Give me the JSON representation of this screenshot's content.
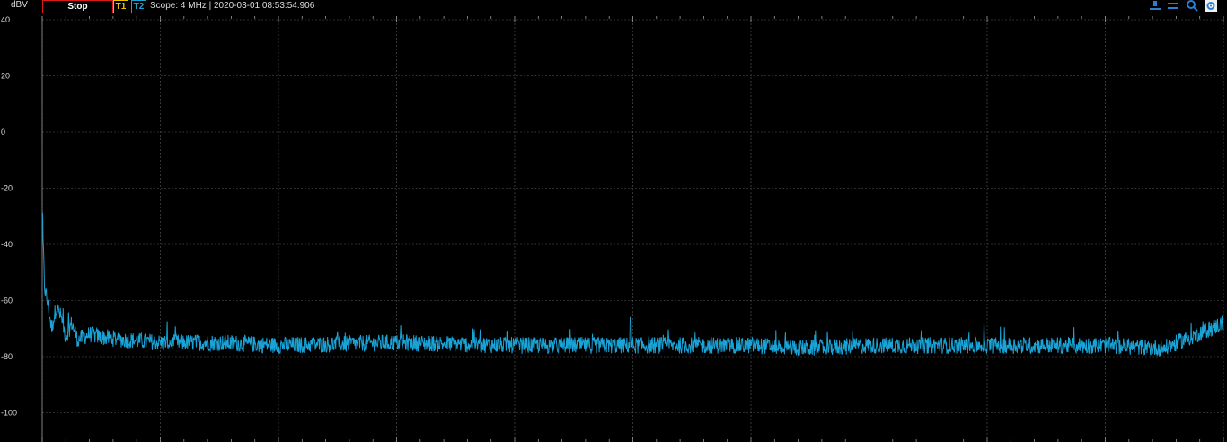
{
  "toolbar": {
    "unit_label": "dBV",
    "stop_label": "Stop",
    "trace1_label": "T1",
    "trace2_label": "T2",
    "status_text": "Scope: 4 MHz | 2020-03-01 08:53:54.906",
    "icons": [
      "cursor-marker-icon",
      "cursor-list-icon",
      "zoom-icon",
      "settings-gear-icon"
    ]
  },
  "colors": {
    "background": "#000000",
    "grid": "#5a5a5a",
    "trace": "#19a3d6",
    "stop_border": "#e01818",
    "t1": "#e6c200",
    "t2": "#19a3d6"
  },
  "chart_data": {
    "type": "line",
    "ylim": [
      -110,
      40
    ],
    "yticks": [
      40,
      20,
      0,
      -20,
      -40,
      -60,
      -80,
      -100
    ],
    "grid": true,
    "vertical_divisions": 10,
    "series": [
      {
        "x": [
          0,
          0.002,
          0.005,
          0.008,
          0.012,
          0.016,
          0.02,
          0.025,
          0.03,
          0.04,
          0.05,
          0.07,
          0.1,
          0.15,
          0.2,
          0.3,
          0.4,
          0.5,
          0.6,
          0.65,
          0.7,
          0.8,
          0.9,
          0.95,
          1.0
        ],
        "y": [
          -30,
          -55,
          -62,
          -70,
          -62,
          -66,
          -73,
          -68,
          -74,
          -72,
          -73,
          -74,
          -75,
          -75,
          -76,
          -75,
          -76,
          -76,
          -76,
          -77,
          -76,
          -76,
          -76,
          -77,
          -68
        ]
      }
    ]
  }
}
